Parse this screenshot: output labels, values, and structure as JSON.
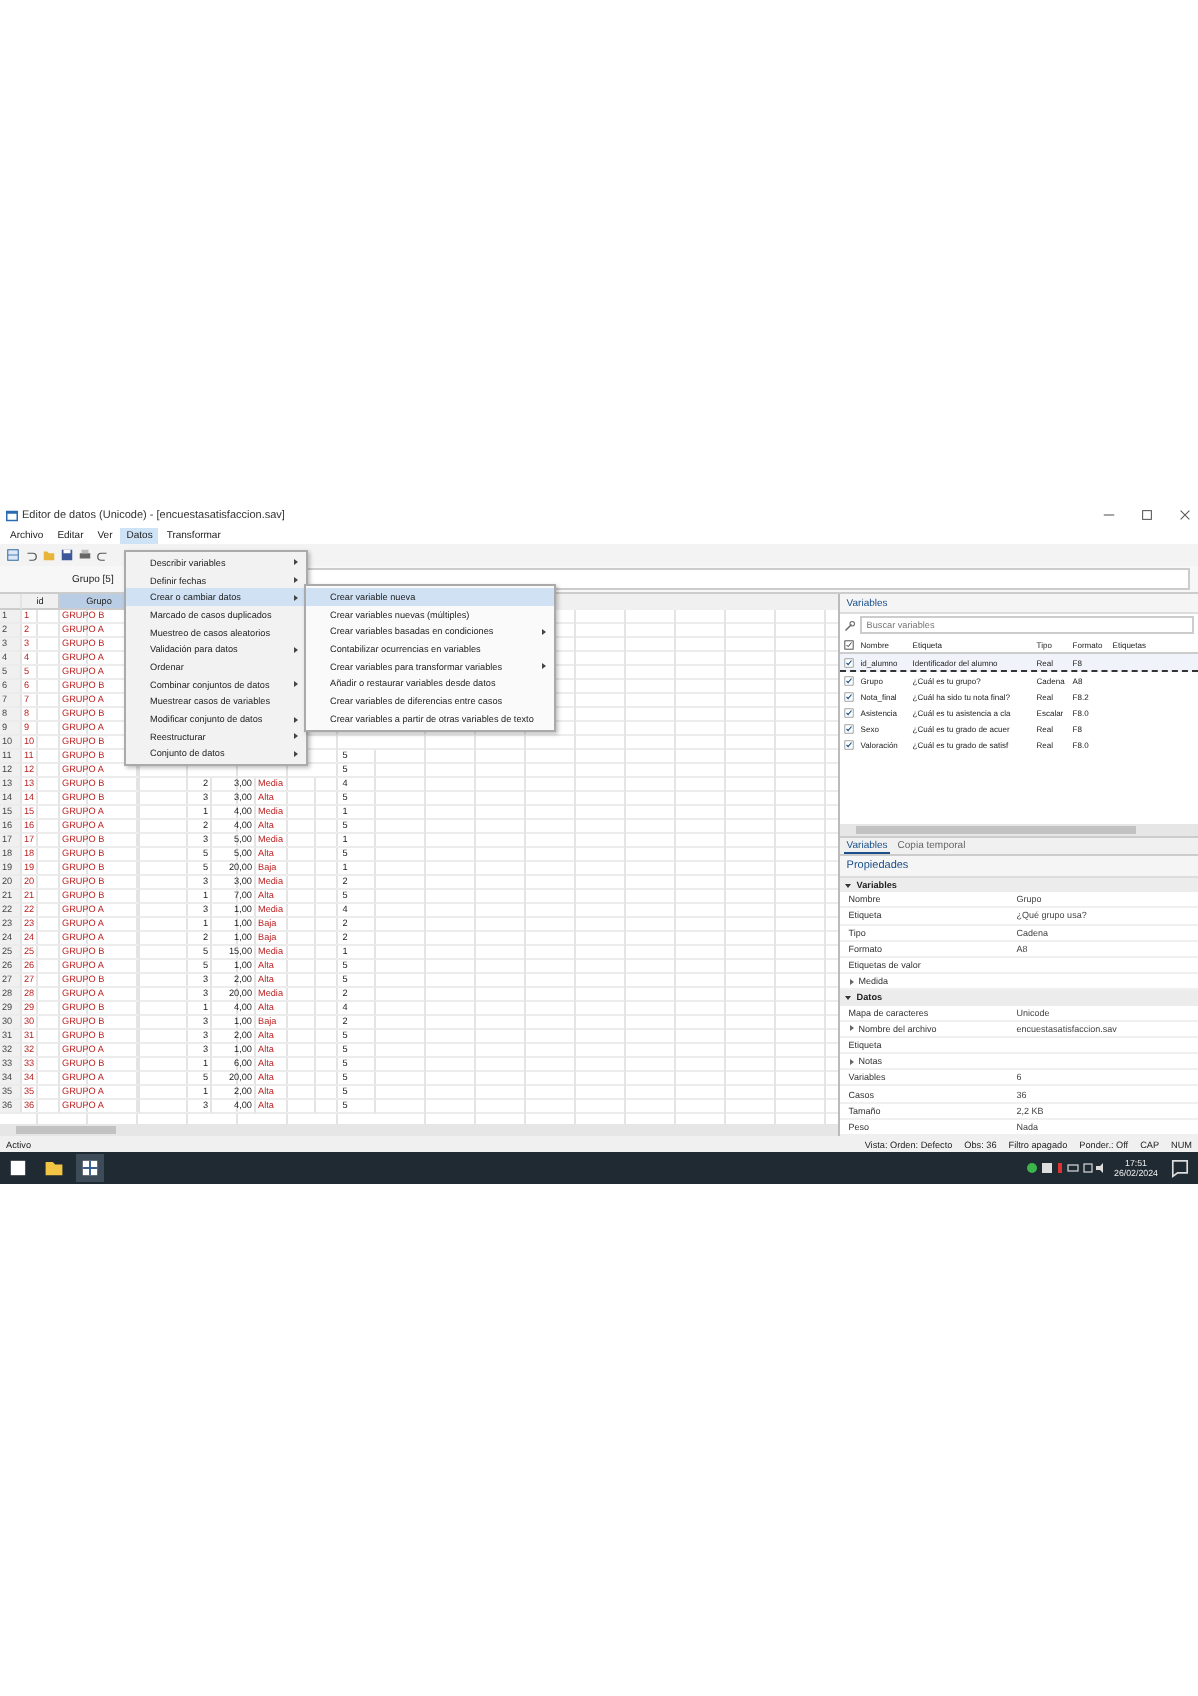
{
  "window": {
    "title": "Editor de datos (Unicode) - [encuestasatisfaccion.sav]"
  },
  "menu_bar": [
    {
      "label": "Archivo",
      "selected": false
    },
    {
      "label": "Editar",
      "selected": false
    },
    {
      "label": "Ver",
      "selected": false
    },
    {
      "label": "Datos",
      "selected": true
    },
    {
      "label": "Transformar",
      "selected": false
    }
  ],
  "cell_editor": {
    "label": "Grupo [5]"
  },
  "grid": {
    "columns": [
      {
        "label": "id",
        "selected": false
      },
      {
        "label": "Grupo",
        "selected": true
      }
    ],
    "rows": [
      {
        "num": "1",
        "id": "1",
        "grupo": "GRUPO B"
      },
      {
        "num": "2",
        "id": "2",
        "grupo": "GRUPO A"
      },
      {
        "num": "3",
        "id": "3",
        "grupo": "GRUPO B"
      },
      {
        "num": "4",
        "id": "4",
        "grupo": "GRUPO A"
      },
      {
        "num": "5",
        "id": "5",
        "grupo": "GRUPO A"
      },
      {
        "num": "6",
        "id": "6",
        "grupo": "GRUPO B"
      },
      {
        "num": "7",
        "id": "7",
        "grupo": "GRUPO A"
      },
      {
        "num": "8",
        "id": "8",
        "grupo": "GRUPO B"
      },
      {
        "num": "9",
        "id": "9",
        "grupo": "GRUPO A"
      },
      {
        "num": "10",
        "id": "10",
        "grupo": "GRUPO B"
      },
      {
        "num": "11",
        "id": "11",
        "grupo": "GRUPO B",
        "column_7": "5"
      },
      {
        "num": "12",
        "id": "12",
        "grupo": "GRUPO A",
        "column_7": "5"
      },
      {
        "num": "13",
        "id": "13",
        "grupo": "GRUPO B",
        "column_4": "2",
        "column_5": "3,00",
        "column_6": "Media",
        "column_7": "4"
      },
      {
        "num": "14",
        "id": "14",
        "grupo": "GRUPO B",
        "column_4": "3",
        "column_5": "3,00",
        "column_6": "Alta",
        "column_7": "5"
      },
      {
        "num": "15",
        "id": "15",
        "grupo": "GRUPO A",
        "column_4": "1",
        "column_5": "4,00",
        "column_6": "Media",
        "column_7": "1"
      },
      {
        "num": "16",
        "id": "16",
        "grupo": "GRUPO A",
        "column_4": "2",
        "column_5": "4,00",
        "column_6": "Alta",
        "column_7": "5"
      },
      {
        "num": "17",
        "id": "17",
        "grupo": "GRUPO B",
        "column_4": "3",
        "column_5": "5,00",
        "column_6": "Media",
        "column_7": "1"
      },
      {
        "num": "18",
        "id": "18",
        "grupo": "GRUPO B",
        "column_4": "5",
        "column_5": "5,00",
        "column_6": "Alta",
        "column_7": "5"
      },
      {
        "num": "19",
        "id": "19",
        "grupo": "GRUPO B",
        "column_4": "5",
        "column_5": "20,00",
        "column_6": "Baja",
        "column_7": "1"
      },
      {
        "num": "20",
        "id": "20",
        "grupo": "GRUPO B",
        "column_4": "3",
        "column_5": "3,00",
        "column_6": "Media",
        "column_7": "2"
      },
      {
        "num": "21",
        "id": "21",
        "grupo": "GRUPO B",
        "column_4": "1",
        "column_5": "7,00",
        "column_6": "Alta",
        "column_7": "5"
      },
      {
        "num": "22",
        "id": "22",
        "grupo": "GRUPO A",
        "column_4": "3",
        "column_5": "1,00",
        "column_6": "Media",
        "column_7": "4"
      },
      {
        "num": "23",
        "id": "23",
        "grupo": "GRUPO A",
        "column_4": "1",
        "column_5": "1,00",
        "column_6": "Baja",
        "column_7": "2"
      },
      {
        "num": "24",
        "id": "24",
        "grupo": "GRUPO A",
        "column_4": "2",
        "column_5": "1,00",
        "column_6": "Baja",
        "column_7": "2"
      },
      {
        "num": "25",
        "id": "25",
        "grupo": "GRUPO B",
        "column_4": "5",
        "column_5": "15,00",
        "column_6": "Media",
        "column_7": "1"
      },
      {
        "num": "26",
        "id": "26",
        "grupo": "GRUPO A",
        "column_4": "5",
        "column_5": "1,00",
        "column_6": "Alta",
        "column_7": "5"
      },
      {
        "num": "27",
        "id": "27",
        "grupo": "GRUPO B",
        "column_4": "3",
        "column_5": "2,00",
        "column_6": "Alta",
        "column_7": "5"
      },
      {
        "num": "28",
        "id": "28",
        "grupo": "GRUPO A",
        "column_4": "3",
        "column_5": "20,00",
        "column_6": "Media",
        "column_7": "2"
      },
      {
        "num": "29",
        "id": "29",
        "grupo": "GRUPO B",
        "column_4": "1",
        "column_5": "4,00",
        "column_6": "Alta",
        "column_7": "4"
      },
      {
        "num": "30",
        "id": "30",
        "grupo": "GRUPO B",
        "column_4": "3",
        "column_5": "1,00",
        "column_6": "Baja",
        "column_7": "2"
      },
      {
        "num": "31",
        "id": "31",
        "grupo": "GRUPO B",
        "column_4": "3",
        "column_5": "2,00",
        "column_6": "Alta",
        "column_7": "5"
      },
      {
        "num": "32",
        "id": "32",
        "grupo": "GRUPO A",
        "column_4": "3",
        "column_5": "1,00",
        "column_6": "Alta",
        "column_7": "5"
      },
      {
        "num": "33",
        "id": "33",
        "grupo": "GRUPO B",
        "column_4": "1",
        "column_5": "6,00",
        "column_6": "Alta",
        "column_7": "5"
      },
      {
        "num": "34",
        "id": "34",
        "grupo": "GRUPO A",
        "column_4": "5",
        "column_5": "20,00",
        "column_6": "Alta",
        "column_7": "5"
      },
      {
        "num": "35",
        "id": "35",
        "grupo": "GRUPO A",
        "column_4": "1",
        "column_5": "2,00",
        "column_6": "Alta",
        "column_7": "5"
      },
      {
        "num": "36",
        "id": "36",
        "grupo": "GRUPO A",
        "column_4": "3",
        "column_5": "4,00",
        "column_6": "Alta",
        "column_7": "5"
      }
    ]
  },
  "data_menu": [
    {
      "label": "Describir variables",
      "has_submenu": true,
      "selected": false
    },
    {
      "label": "Definir fechas",
      "has_submenu": true,
      "selected": false
    },
    {
      "label": "Crear o cambiar datos",
      "has_submenu": true,
      "selected": true
    },
    {
      "label": "Marcado de casos duplicados",
      "has_submenu": false,
      "selected": false
    },
    {
      "label": "Muestreo de casos aleatorios",
      "has_submenu": false,
      "selected": false
    },
    {
      "label": "Validación para datos",
      "has_submenu": true,
      "selected": false
    },
    {
      "label": "Ordenar",
      "has_submenu": false,
      "selected": false
    },
    {
      "label": "Combinar conjuntos de datos",
      "has_submenu": true,
      "selected": false
    },
    {
      "label": "Muestrear casos de variables",
      "has_submenu": false,
      "selected": false
    },
    {
      "label": "Modificar conjunto de datos",
      "has_submenu": true,
      "selected": false
    },
    {
      "label": "Reestructurar",
      "has_submenu": true,
      "selected": false
    },
    {
      "label": "Conjunto de datos",
      "has_submenu": true,
      "selected": false
    }
  ],
  "submenu": [
    {
      "label": "Crear variable nueva",
      "has_submenu": false,
      "selected": true
    },
    {
      "label": "Crear variables nuevas (múltiples)",
      "has_submenu": false,
      "selected": false
    },
    {
      "label": "Crear variables basadas en condiciones",
      "has_submenu": true,
      "selected": false
    },
    {
      "label": "Contabilizar ocurrencias en variables",
      "has_submenu": false,
      "selected": false
    },
    {
      "label": "Crear variables para transformar variables",
      "has_submenu": true,
      "selected": false
    },
    {
      "label": "Añadir o restaurar variables desde datos",
      "has_submenu": false,
      "selected": false
    },
    {
      "label": "Crear variables de diferencias entre casos",
      "has_submenu": false,
      "selected": false
    },
    {
      "label": "Crear variables a partir de otras variables de texto",
      "has_submenu": false,
      "selected": false
    }
  ],
  "variables_panel": {
    "title": "Variables",
    "search": {
      "placeholder": "Buscar variables"
    },
    "columns": [
      "Nombre",
      "Etiqueta",
      "Tipo",
      "Formato",
      "Etiquetas"
    ],
    "rows": [
      {
        "name": "id_alumno",
        "label": "Identificador del alumno",
        "type": "Real",
        "format": "F8",
        "checked": true,
        "selected": true
      },
      {
        "name": "Grupo",
        "label": "¿Cuál es tu grupo?",
        "type": "Cadena",
        "format": "A8",
        "checked": true,
        "selected": false
      },
      {
        "name": "Nota_final",
        "label": "¿Cuál ha sido tu nota final?",
        "type": "Real",
        "format": "F8.2",
        "checked": true,
        "selected": false
      },
      {
        "name": "Asistencia",
        "label": "¿Cuál es tu asistencia a cla",
        "type": "Escalar",
        "format": "F8.0",
        "checked": true,
        "selected": false
      },
      {
        "name": "Sexo",
        "label": "¿Cuál es tu grado de acuer",
        "type": "Real",
        "format": "F8",
        "checked": true,
        "selected": false
      },
      {
        "name": "Valoración",
        "label": "¿Cuál es tu grado de satisf",
        "type": "Real",
        "format": "F8.0",
        "checked": true,
        "selected": false
      }
    ]
  },
  "panel_tabs": [
    {
      "label": "Variables",
      "selected": true
    },
    {
      "label": "Copia temporal",
      "selected": false
    }
  ],
  "properties": {
    "title": "Propiedades",
    "sections": [
      {
        "label": "Variables",
        "expanded": true,
        "rows": [
          {
            "name": "Nombre",
            "value": "Grupo"
          },
          {
            "name": "Etiqueta",
            "value": "¿Qué grupo usa?"
          },
          {
            "name": "Tipo",
            "value": "Cadena"
          },
          {
            "name": "Formato",
            "value": "A8"
          },
          {
            "name": "Etiquetas de valor"
          },
          {
            "name": "Medida",
            "expandable": true
          }
        ]
      },
      {
        "label": "Datos",
        "expanded": true,
        "rows": [
          {
            "name": "Mapa de caracteres",
            "value": "Unicode"
          },
          {
            "name": "Nombre del archivo",
            "value": "encuestasatisfaccion.sav",
            "expandable": true
          },
          {
            "name": "Etiqueta"
          },
          {
            "name": "Notas",
            "expandable": true
          },
          {
            "name": "Variables",
            "value": "6"
          },
          {
            "name": "Casos",
            "value": "36"
          },
          {
            "name": "Tamaño",
            "value": "2,2 KB"
          },
          {
            "name": "Peso",
            "value": "Nada"
          }
        ]
      }
    ]
  },
  "status_bar": {
    "left": "Activo",
    "items": [
      "Vista: Orden: Defecto",
      "Obs: 36",
      "Filtro apagado",
      "Ponder.: Off",
      "CAP",
      "NUM"
    ]
  },
  "taskbar": {
    "apps": [
      {
        "kind": "start",
        "selected": false
      },
      {
        "kind": "folder",
        "selected": false
      },
      {
        "kind": "app",
        "selected": true
      }
    ],
    "time": "17:51",
    "date": "26/02/2024"
  }
}
